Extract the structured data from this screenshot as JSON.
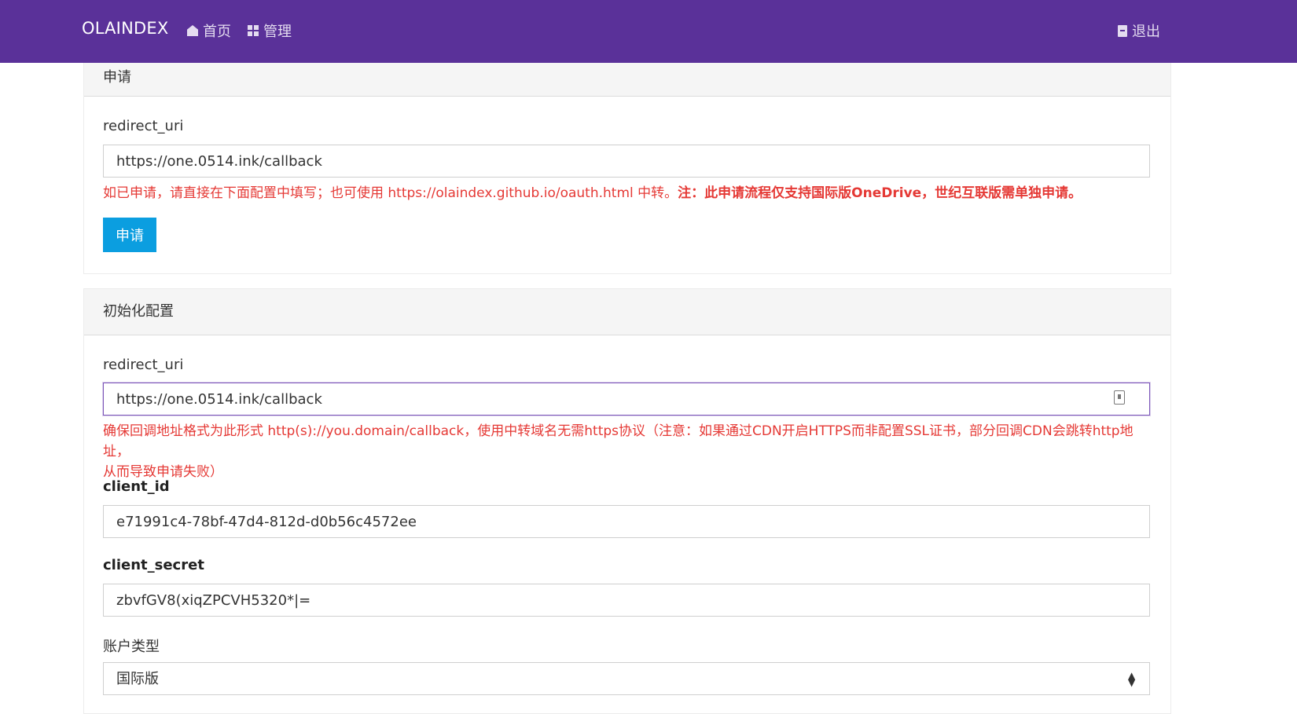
{
  "navbar": {
    "brand": "OLAINDEX",
    "home_label": "首页",
    "admin_label": "管理",
    "logout_label": "退出"
  },
  "apply_panel": {
    "heading": "申请",
    "redirect_label": "redirect_uri",
    "redirect_value": "https://one.0514.ink/callback",
    "help_text": "如已申请，请直接在下面配置中填写；也可使用 https://olaindex.github.io/oauth.html 中转。",
    "help_bold": "注：此申请流程仅支持国际版OneDrive，世纪互联版需单独申请。",
    "apply_button": "申请"
  },
  "init_panel": {
    "heading": "初始化配置",
    "redirect_label": "redirect_uri",
    "redirect_value": "https://one.0514.ink/callback",
    "redirect_help_line1": "确保回调地址格式为此形式 http(s)://you.domain/callback，使用中转域名无需https协议（注意：如果通过CDN开启HTTPS而非配置SSL证书，部分回调CDN会跳转http地址，",
    "redirect_help_line2": "从而导致申请失败）",
    "client_id_label": "client_id",
    "client_id_value": "e71991c4-78bf-47d4-812d-d0b56c4572ee",
    "client_secret_label": "client_secret",
    "client_secret_value": "zbvfGV8(xiqZPCVH5320*|=",
    "account_type_label": "账户类型",
    "account_type_value": "国际版"
  },
  "colors": {
    "navbar": "#5a3199",
    "button": "#0b9ee0",
    "help_text": "#e53935"
  },
  "icons": {
    "home": "home-icon",
    "admin": "grid-icon",
    "logout": "logout-icon",
    "field": "contact-card-icon",
    "select": "updown-arrows-icon"
  }
}
